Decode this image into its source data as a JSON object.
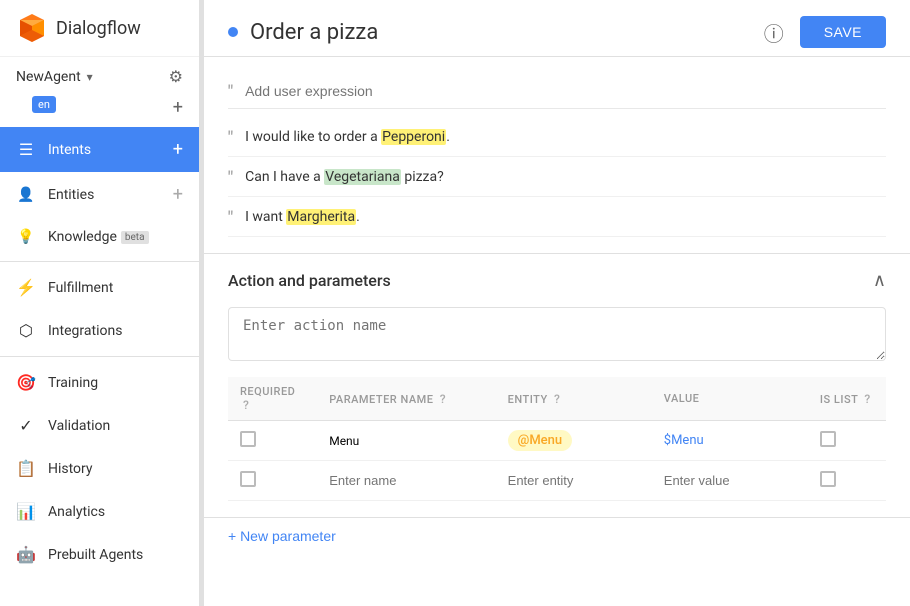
{
  "sidebar": {
    "logo_text": "Dialogflow",
    "agent_name": "NewAgent",
    "lang": "en",
    "items": [
      {
        "id": "intents",
        "label": "Intents",
        "icon": "≡",
        "has_plus": true,
        "active": true
      },
      {
        "id": "entities",
        "label": "Entities",
        "icon": "👤",
        "has_plus": true,
        "active": false
      },
      {
        "id": "knowledge",
        "label": "Knowledge",
        "badge": "beta",
        "icon": "📚",
        "has_plus": false,
        "active": false
      },
      {
        "id": "fulfillment",
        "label": "Fulfillment",
        "icon": "⚡",
        "has_plus": false,
        "active": false
      },
      {
        "id": "integrations",
        "label": "Integrations",
        "icon": "🔗",
        "has_plus": false,
        "active": false
      },
      {
        "id": "training",
        "label": "Training",
        "icon": "🎯",
        "has_plus": false,
        "active": false
      },
      {
        "id": "validation",
        "label": "Validation",
        "icon": "✓",
        "has_plus": false,
        "active": false
      },
      {
        "id": "history",
        "label": "History",
        "icon": "📋",
        "has_plus": false,
        "active": false
      },
      {
        "id": "analytics",
        "label": "Analytics",
        "icon": "📊",
        "has_plus": false,
        "active": false
      },
      {
        "id": "prebuilt",
        "label": "Prebuilt Agents",
        "icon": "🤖",
        "has_plus": false,
        "active": false
      }
    ]
  },
  "header": {
    "title": "Order a pizza",
    "save_label": "SAVE"
  },
  "expressions": {
    "placeholder": "Add user expression",
    "items": [
      {
        "text_before": "I would like to order a ",
        "highlight": "Pepperoni",
        "text_after": "."
      },
      {
        "text_before": "Can I have a ",
        "highlight": "Vegetariana",
        "text_after": " pizza?"
      },
      {
        "text_before": "I want ",
        "highlight": "Margherita",
        "text_after": "."
      }
    ]
  },
  "action_section": {
    "title": "Action and parameters",
    "action_placeholder": "Enter action name",
    "table": {
      "headers": {
        "required": "REQUIRED",
        "param_name": "PARAMETER NAME",
        "entity": "ENTITY",
        "value": "VALUE",
        "is_list": "IS LIST"
      },
      "rows": [
        {
          "required": false,
          "param_name": "Menu",
          "entity": "@Menu",
          "value": "$Menu",
          "is_list": false
        },
        {
          "required": false,
          "param_name": "",
          "param_placeholder": "Enter name",
          "entity": "",
          "entity_placeholder": "Enter entity",
          "value": "",
          "value_placeholder": "Enter value",
          "is_list": false
        }
      ]
    },
    "new_param_label": "+ New parameter"
  }
}
